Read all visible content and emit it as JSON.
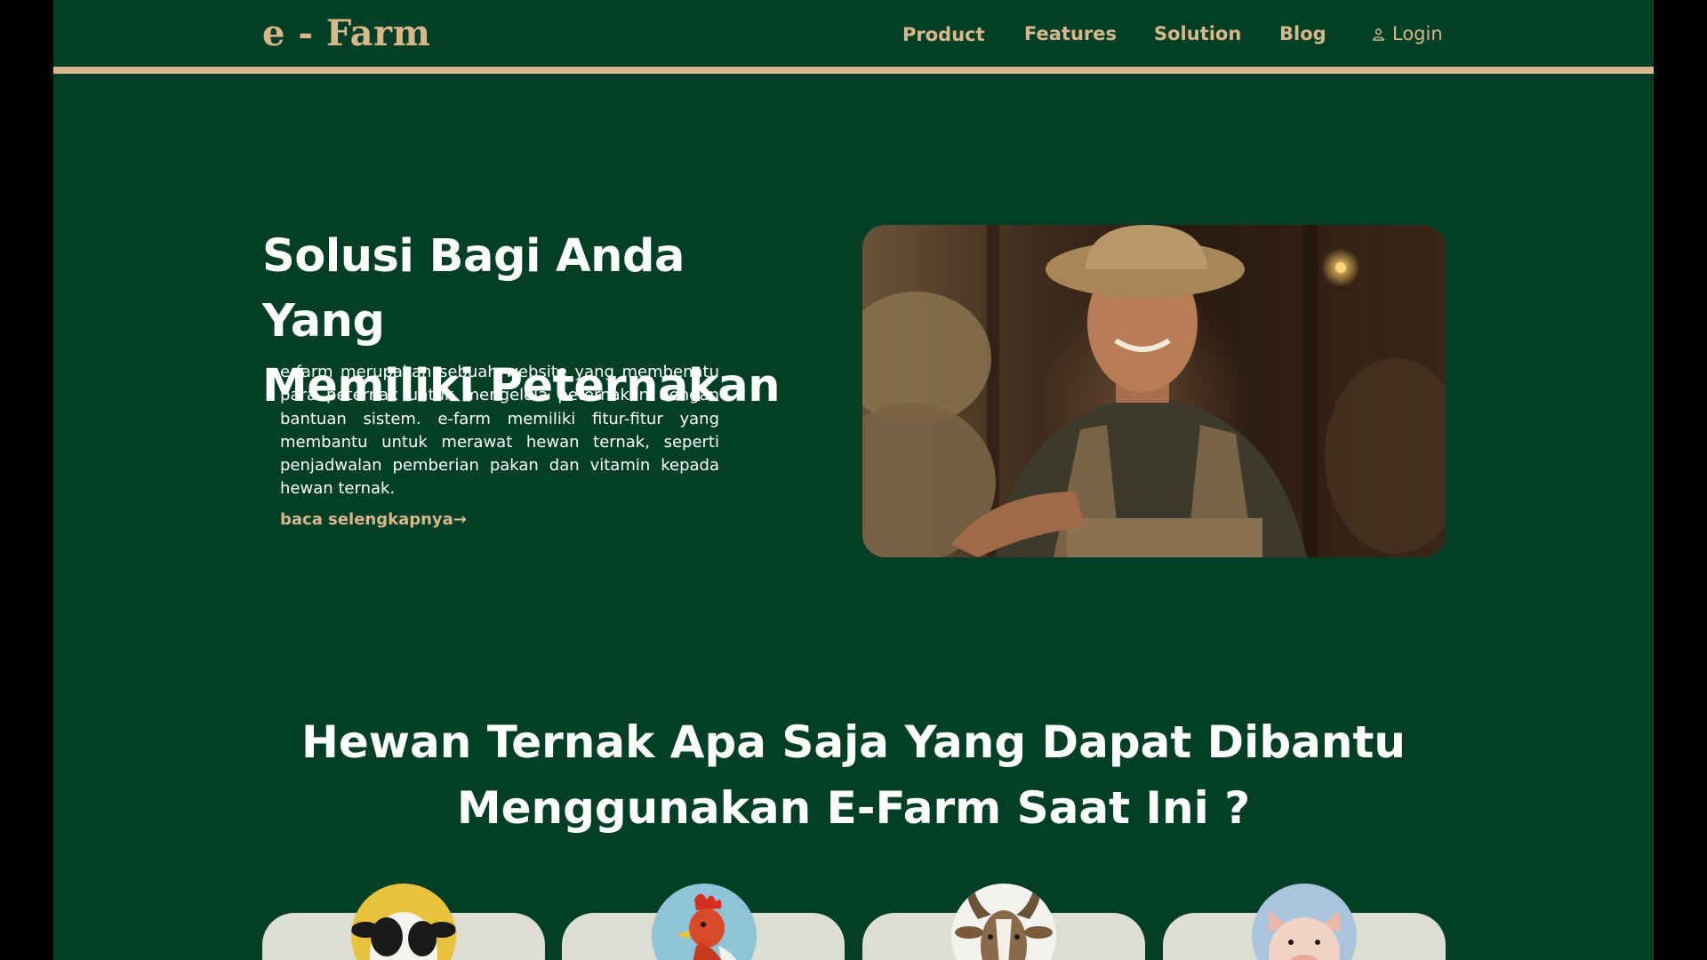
{
  "nav": {
    "logo": "e - Farm",
    "items": [
      "Product",
      "Features",
      "Solution",
      "Blog"
    ],
    "login": "Login"
  },
  "hero": {
    "title_line1": "Solusi Bagi Anda Yang",
    "title_line2": "Memiliki Peternakan",
    "description": "e-farm merupakan sebuah website yang membenatu para peternak untuk mengelola peternakan dengan bantuan sistem. e-farm memiliki fitur-fitur yang membantu untuk merawat hewan ternak, seperti penjadwalan pemberian pakan dan vitamin kepada hewan ternak.",
    "read_more": "baca selengkapnya→"
  },
  "section": {
    "title_line1": "Hewan Ternak Apa Saja Yang Dapat Dibantu",
    "title_line2": "Menggunakan E-Farm Saat Ini ?"
  },
  "animals": [
    {
      "icon": "cow-icon",
      "bg": "#e8c23a"
    },
    {
      "icon": "chicken-icon",
      "bg": "#8fc3d8"
    },
    {
      "icon": "goat-icon",
      "bg": "#f4f2ee"
    },
    {
      "icon": "pig-icon",
      "bg": "#a9c4dc"
    }
  ],
  "colors": {
    "background": "#023f26",
    "accent": "#d8b88a",
    "card": "#deddd2"
  }
}
